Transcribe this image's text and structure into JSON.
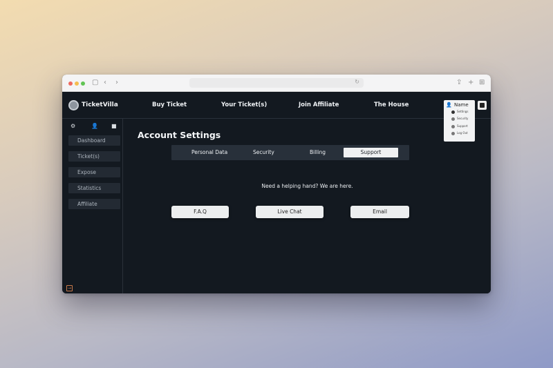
{
  "browser": {
    "url": ""
  },
  "topnav": {
    "brand": "TicketVilla",
    "links": [
      "Buy Ticket",
      "Your Ticket(s)",
      "Join Affiliate",
      "The House"
    ]
  },
  "profile_menu": {
    "name": "Name",
    "items": [
      "Settings",
      "Security",
      "Support",
      "Log Out"
    ]
  },
  "sidebar": {
    "items": [
      "Dashboard",
      "Ticket(s)",
      "Expose",
      "Statistics",
      "Affiliate"
    ]
  },
  "main": {
    "title": "Account Settings",
    "tabs": [
      "Personal  Data",
      "Security",
      "Billing",
      "Support"
    ],
    "active_tab": "Support",
    "help_text": "Need a helping hand? We are here.",
    "buttons": [
      "F.A.Q",
      "Live Chat",
      "Email"
    ]
  },
  "colors": {
    "app_bg": "#131920",
    "panel": "#232a33",
    "tab_bar": "#28303a",
    "light_button": "#eceeef"
  }
}
